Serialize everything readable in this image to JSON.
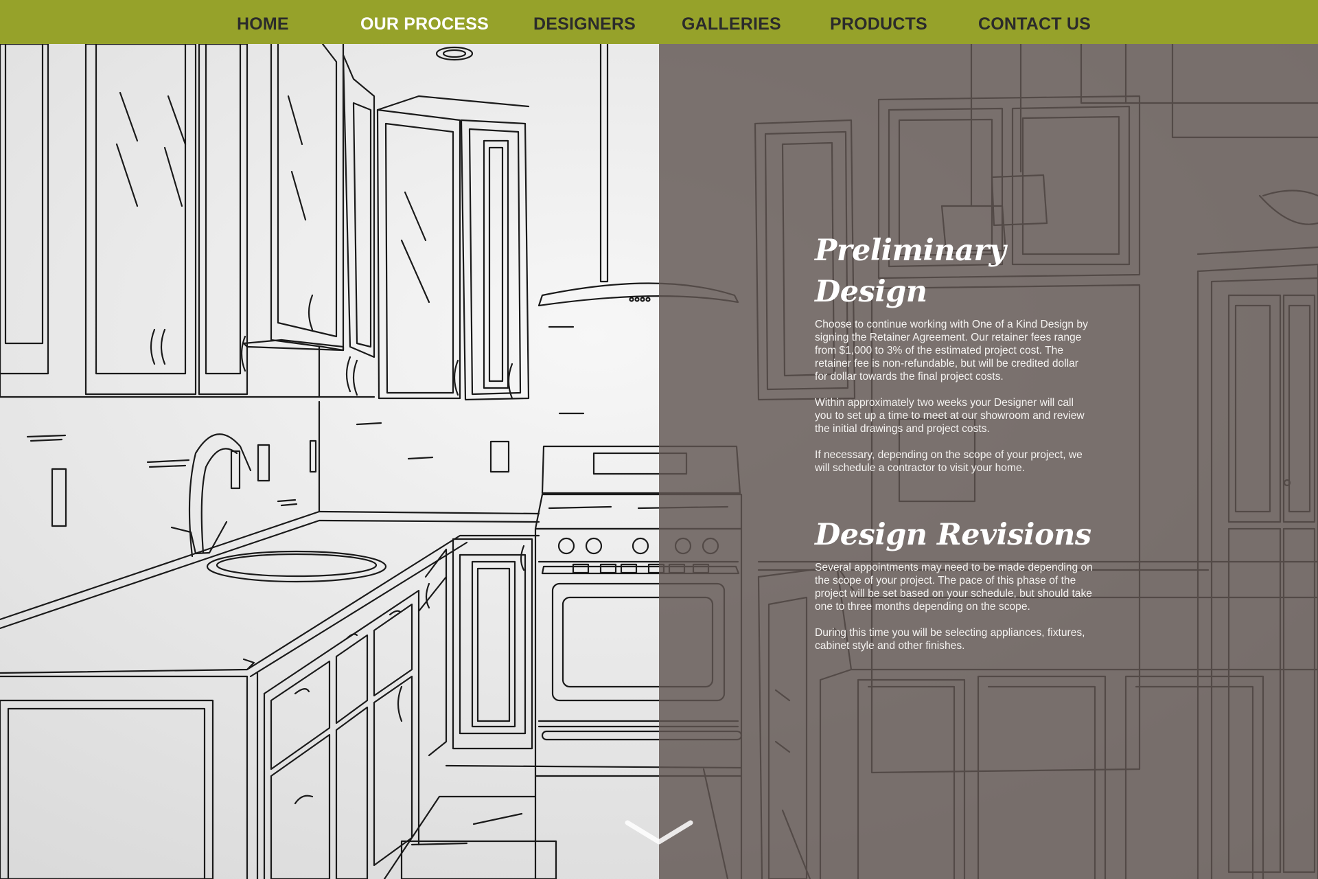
{
  "nav": {
    "items": [
      {
        "label": "HOME",
        "active": false
      },
      {
        "label": "OUR PROCESS",
        "active": true
      },
      {
        "label": "DESIGNERS",
        "active": false
      },
      {
        "label": "GALLERIES",
        "active": false
      },
      {
        "label": "PRODUCTS",
        "active": false
      },
      {
        "label": "CONTACT US",
        "active": false
      }
    ]
  },
  "sections": {
    "preliminary": {
      "title": "Preliminary Design",
      "paragraphs": [
        "Choose to continue working with One of a Kind Design by signing the Retainer Agreement. Our retainer fees range from $1,000 to 3% of the estimated project cost. The retainer fee is non-refundable, but will be credited dollar for dollar towards the final project costs.",
        "Within approximately two weeks your Designer will call you to set up a time to meet at our showroom and review the initial drawings and project costs.",
        "If necessary, depending on the scope of your project, we will schedule a contractor to visit your home."
      ]
    },
    "revisions": {
      "title": "Design Revisions",
      "paragraphs": [
        "Several appointments may need to be made depending on the scope of your project. The pace of this phase of the project will be set based on your schedule, but should take one to three months depending on the scope.",
        "During this time you will be selecting appliances, fixtures, cabinet style and other finishes."
      ]
    }
  },
  "scroll_indicator": {
    "icon": "chevron-down-icon"
  },
  "colors": {
    "nav_background": "#96a22a",
    "nav_text": "#2b2b2b",
    "nav_active_text": "#ffffff",
    "overlay": "#605652",
    "sketch_line": "#1a1a1a"
  }
}
